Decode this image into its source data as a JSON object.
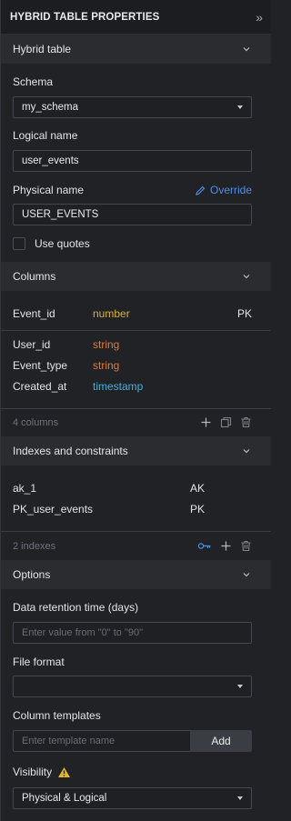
{
  "header": {
    "title": "HYBRID TABLE PROPERTIES",
    "collapse_glyph": "»"
  },
  "hybrid": {
    "section_label": "Hybrid table",
    "schema_label": "Schema",
    "schema_value": "my_schema",
    "logical_label": "Logical name",
    "logical_value": "user_events",
    "physical_label": "Physical name",
    "override_label": "Override",
    "physical_value": "USER_EVENTS",
    "quotes_label": "Use quotes"
  },
  "columns": {
    "section_label": "Columns",
    "pk_rows": [
      {
        "name": "Event_id",
        "type": "number",
        "type_color": "#d7b33c",
        "key": "PK"
      }
    ],
    "rows": [
      {
        "name": "User_id",
        "type": "string",
        "type_color": "#e3793a"
      },
      {
        "name": "Event_type",
        "type": "string",
        "type_color": "#e3793a"
      },
      {
        "name": "Created_at",
        "type": "timestamp",
        "type_color": "#3fb3e6"
      }
    ],
    "count_label": "4 columns"
  },
  "indexes": {
    "section_label": "Indexes and constraints",
    "rows": [
      {
        "name": "ak_1",
        "type": "AK"
      },
      {
        "name": "PK_user_events",
        "type": "PK"
      }
    ],
    "count_label": "2 indexes",
    "key_icon_color": "#4f8fe6"
  },
  "options": {
    "section_label": "Options",
    "retention_label": "Data retention time (days)",
    "retention_placeholder": "Enter value from \"0\" to \"90\"",
    "file_format_label": "File format",
    "file_format_value": "",
    "templates_label": "Column templates",
    "templates_placeholder": "Enter template name",
    "add_label": "Add",
    "visibility_label": "Visibility",
    "visibility_value": "Physical & Logical",
    "warning_color": "#e5b728"
  }
}
